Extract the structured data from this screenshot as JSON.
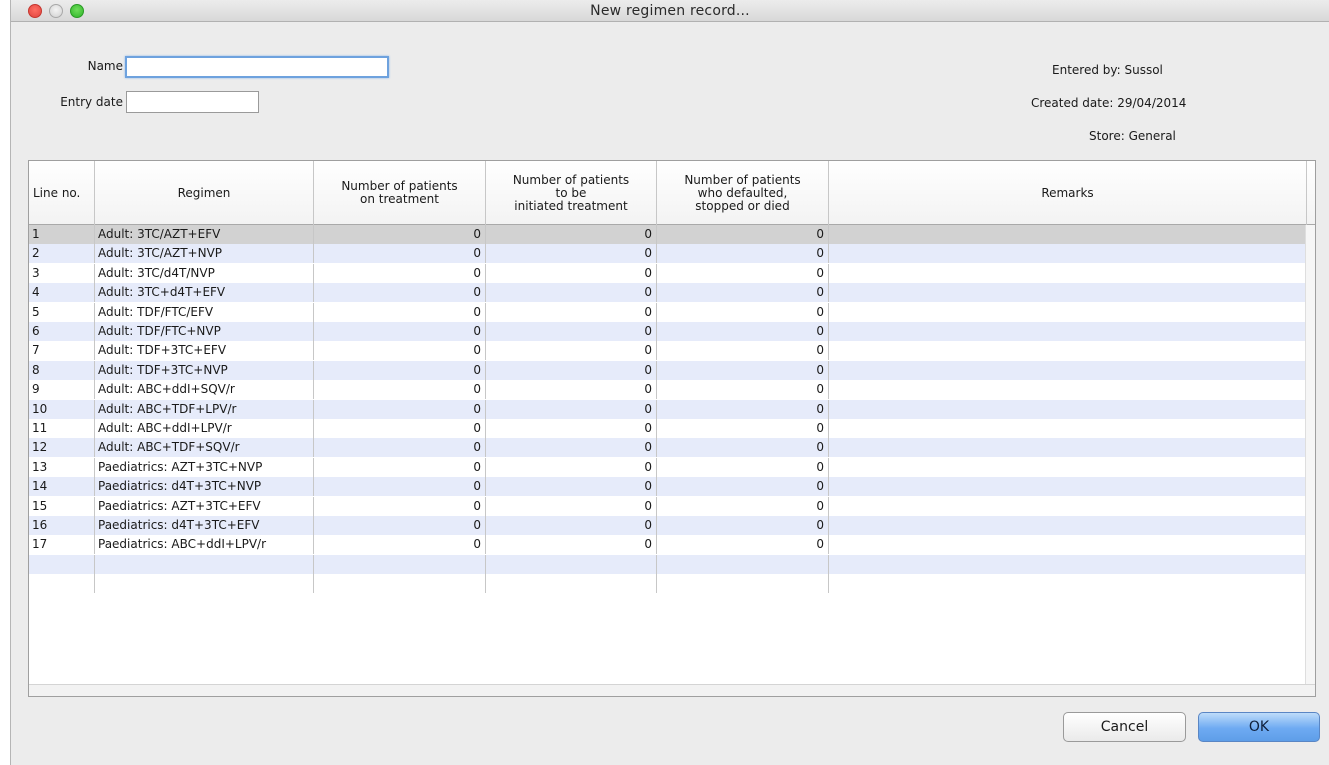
{
  "window": {
    "title": "New regimen record..."
  },
  "form": {
    "name_label": "Name",
    "name_value": "",
    "entry_date_label": "Entry date",
    "entry_date_value": ""
  },
  "info": {
    "entered_by_label": "Entered by:",
    "entered_by_value": "Sussol",
    "created_date_label": "Created date:",
    "created_date_value": "29/04/2014",
    "store_label": "Store:",
    "store_value": "General"
  },
  "table": {
    "columns": [
      "Line no.",
      "Regimen",
      "Number of patients\non treatment",
      "Number of patients\nto be\ninitiated treatment",
      "Number of patients\nwho defaulted,\nstopped or died",
      "Remarks"
    ],
    "rows": [
      {
        "line": "1",
        "regimen": "Adult: 3TC/AZT+EFV",
        "on_treatment": "0",
        "to_initiate": "0",
        "defaulted": "0",
        "remarks": ""
      },
      {
        "line": "2",
        "regimen": "Adult: 3TC/AZT+NVP",
        "on_treatment": "0",
        "to_initiate": "0",
        "defaulted": "0",
        "remarks": ""
      },
      {
        "line": "3",
        "regimen": "Adult: 3TC/d4T/NVP",
        "on_treatment": "0",
        "to_initiate": "0",
        "defaulted": "0",
        "remarks": ""
      },
      {
        "line": "4",
        "regimen": "Adult: 3TC+d4T+EFV",
        "on_treatment": "0",
        "to_initiate": "0",
        "defaulted": "0",
        "remarks": ""
      },
      {
        "line": "5",
        "regimen": "Adult: TDF/FTC/EFV",
        "on_treatment": "0",
        "to_initiate": "0",
        "defaulted": "0",
        "remarks": ""
      },
      {
        "line": "6",
        "regimen": "Adult: TDF/FTC+NVP",
        "on_treatment": "0",
        "to_initiate": "0",
        "defaulted": "0",
        "remarks": ""
      },
      {
        "line": "7",
        "regimen": "Adult: TDF+3TC+EFV",
        "on_treatment": "0",
        "to_initiate": "0",
        "defaulted": "0",
        "remarks": ""
      },
      {
        "line": "8",
        "regimen": "Adult: TDF+3TC+NVP",
        "on_treatment": "0",
        "to_initiate": "0",
        "defaulted": "0",
        "remarks": ""
      },
      {
        "line": "9",
        "regimen": "Adult: ABC+ddI+SQV/r",
        "on_treatment": "0",
        "to_initiate": "0",
        "defaulted": "0",
        "remarks": ""
      },
      {
        "line": "10",
        "regimen": "Adult: ABC+TDF+LPV/r",
        "on_treatment": "0",
        "to_initiate": "0",
        "defaulted": "0",
        "remarks": ""
      },
      {
        "line": "11",
        "regimen": "Adult: ABC+ddI+LPV/r",
        "on_treatment": "0",
        "to_initiate": "0",
        "defaulted": "0",
        "remarks": ""
      },
      {
        "line": "12",
        "regimen": "Adult: ABC+TDF+SQV/r",
        "on_treatment": "0",
        "to_initiate": "0",
        "defaulted": "0",
        "remarks": ""
      },
      {
        "line": "13",
        "regimen": "Paediatrics: AZT+3TC+NVP",
        "on_treatment": "0",
        "to_initiate": "0",
        "defaulted": "0",
        "remarks": ""
      },
      {
        "line": "14",
        "regimen": "Paediatrics: d4T+3TC+NVP",
        "on_treatment": "0",
        "to_initiate": "0",
        "defaulted": "0",
        "remarks": ""
      },
      {
        "line": "15",
        "regimen": "Paediatrics: AZT+3TC+EFV",
        "on_treatment": "0",
        "to_initiate": "0",
        "defaulted": "0",
        "remarks": ""
      },
      {
        "line": "16",
        "regimen": "Paediatrics: d4T+3TC+EFV",
        "on_treatment": "0",
        "to_initiate": "0",
        "defaulted": "0",
        "remarks": ""
      },
      {
        "line": "17",
        "regimen": "Paediatrics: ABC+ddI+LPV/r",
        "on_treatment": "0",
        "to_initiate": "0",
        "defaulted": "0",
        "remarks": ""
      }
    ],
    "selected_row": "1"
  },
  "buttons": {
    "cancel_label": "Cancel",
    "ok_label": "OK"
  },
  "colors": {
    "row_alt": "#e6ebfa",
    "row_selected": "#d2d2d2",
    "ok_button": "#6eaaf2"
  }
}
